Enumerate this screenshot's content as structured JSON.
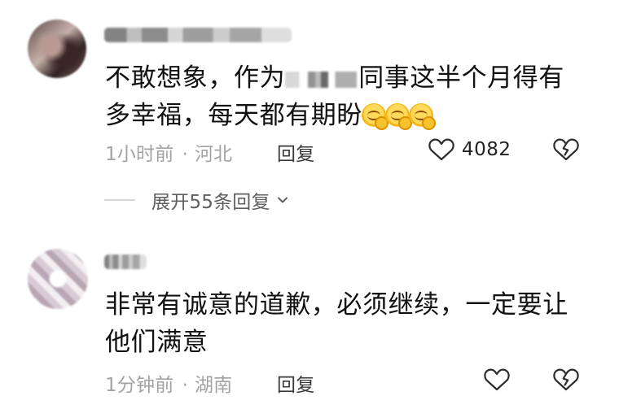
{
  "comments": [
    {
      "text_before": "不敢想象，作为",
      "text_after": "同事这半个月得有多幸福，每天都有期盼",
      "time_location": "1小时前 · 河北",
      "time": "1小时前",
      "location": "河北",
      "reply_label": "回复",
      "likes": "4082",
      "expand_replies": "展开55条回复"
    },
    {
      "text": "非常有诚意的道歉，必须继续，一定要让他们满意",
      "time": "1分钟前",
      "location": "湖南",
      "reply_label": "回复"
    }
  ],
  "icons": {
    "like": "heart-outline-icon",
    "dislike": "broken-heart-outline-icon",
    "expand": "chevron-down-icon",
    "emoji": "kissing-face-icon"
  },
  "colors": {
    "text": "#111111",
    "meta": "#a3a3a3",
    "expand": "#5f5f5f",
    "background": "#ffffff"
  }
}
